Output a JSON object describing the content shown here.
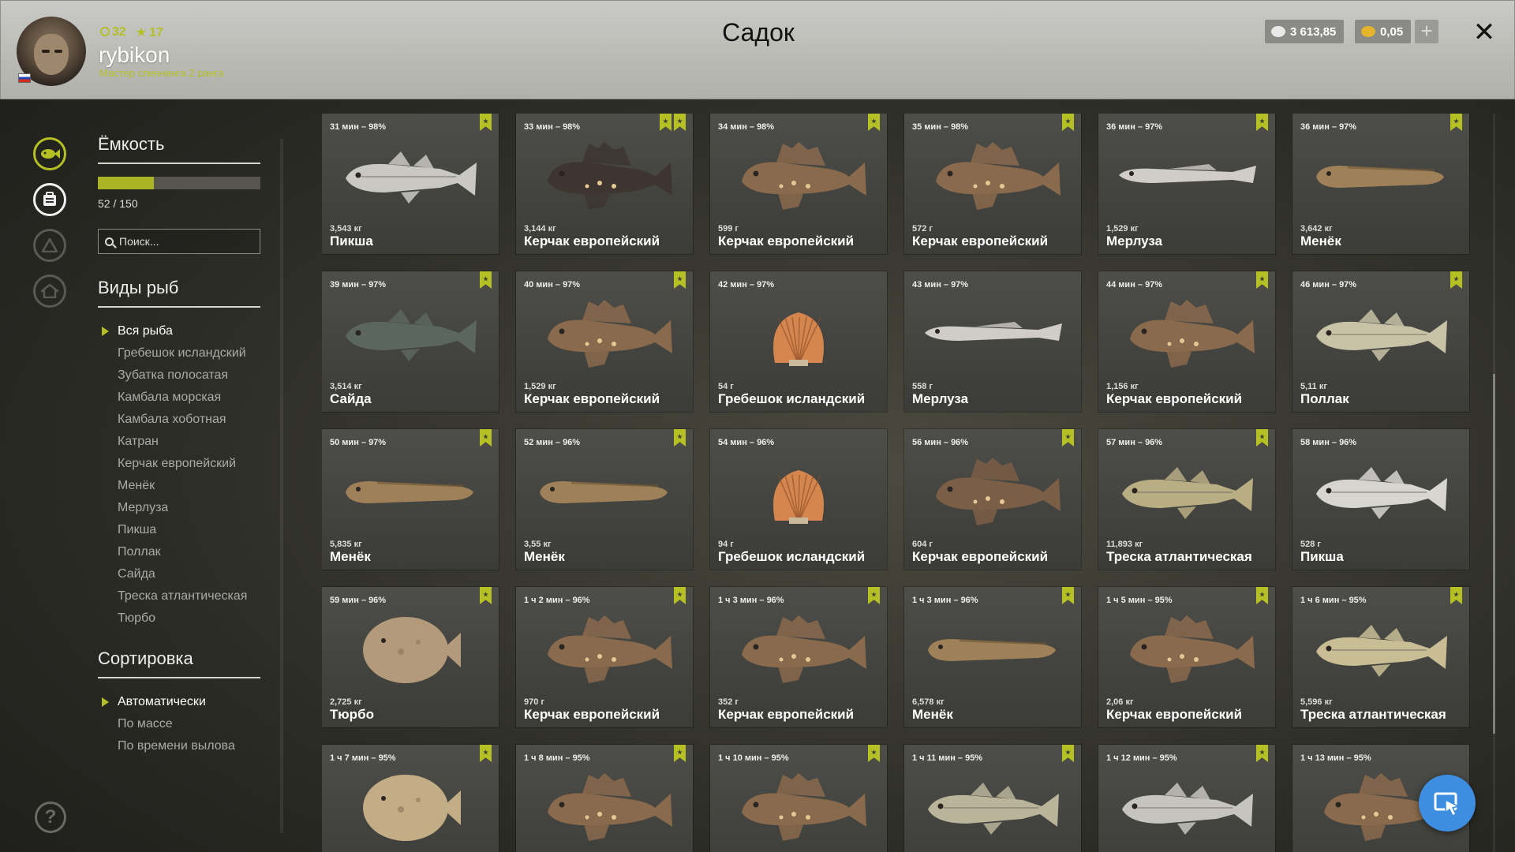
{
  "header": {
    "title": "Садок",
    "username": "rybikon",
    "rank_title": "Мастер спиннинга 2 ранга",
    "level": "32",
    "stars": "17",
    "silver": "3 613,85",
    "gold": "0,05",
    "plus_label": "+",
    "close_label": "✕"
  },
  "sidebar": {
    "capacity_title": "Ёмкость",
    "capacity_used": 52,
    "capacity_max": 150,
    "capacity_text": "52 / 150",
    "search_placeholder": "Поиск...",
    "species_title": "Виды рыб",
    "species": [
      "Вся рыба",
      "Гребешок исландский",
      "Зубатка полосатая",
      "Камбала морская",
      "Камбала хоботная",
      "Катран",
      "Керчак европейский",
      "Менёк",
      "Мерлуза",
      "Пикша",
      "Поллак",
      "Сайда",
      "Треска атлантическая",
      "Тюрбо"
    ],
    "species_selected": 0,
    "sort_title": "Сортировка",
    "sort_options": [
      "Автоматически",
      "По массе",
      "По времени вылова"
    ],
    "sort_selected": 0,
    "help_label": "?"
  },
  "colors": {
    "accent": "#b4c024",
    "fab": "#3d8de0"
  },
  "fish": [
    {
      "time": "31 мин – 98%",
      "weight": "3,543 кг",
      "name": "Пикша",
      "kind": "cod",
      "color": "#c9c8c2",
      "marks": 1
    },
    {
      "time": "33 мин – 98%",
      "weight": "3,144 кг",
      "name": "Керчак европейский",
      "kind": "sculpin",
      "color": "#3e3530",
      "marks": 2
    },
    {
      "time": "34 мин – 98%",
      "weight": "599 г",
      "name": "Керчак европейский",
      "kind": "sculpin",
      "color": "#8a6a4c",
      "marks": 1
    },
    {
      "time": "35 мин – 98%",
      "weight": "572 г",
      "name": "Керчак европейский",
      "kind": "sculpin",
      "color": "#8a6a4c",
      "marks": 1
    },
    {
      "time": "36 мин – 97%",
      "weight": "1,529 кг",
      "name": "Мерлуза",
      "kind": "hake",
      "color": "#d0ccc8",
      "marks": 1
    },
    {
      "time": "36 мин – 97%",
      "weight": "3,642 кг",
      "name": "Менёк",
      "kind": "eel",
      "color": "#9e8158",
      "marks": 1
    },
    {
      "time": "39 мин – 97%",
      "weight": "3,514 кг",
      "name": "Сайда",
      "kind": "cod",
      "color": "#5c6660",
      "marks": 1
    },
    {
      "time": "40 мин – 97%",
      "weight": "1,529 кг",
      "name": "Керчак европейский",
      "kind": "sculpin",
      "color": "#8a6a4c",
      "marks": 1
    },
    {
      "time": "42 мин – 97%",
      "weight": "54 г",
      "name": "Гребешок исландский",
      "kind": "shell",
      "color": "#d4864e",
      "marks": 0
    },
    {
      "time": "43 мин – 97%",
      "weight": "558 г",
      "name": "Мерлуза",
      "kind": "hake",
      "color": "#d0ccc8",
      "marks": 0
    },
    {
      "time": "44 мин – 97%",
      "weight": "1,156 кг",
      "name": "Керчак европейский",
      "kind": "sculpin",
      "color": "#8a6a4c",
      "marks": 1
    },
    {
      "time": "46 мин – 97%",
      "weight": "5,11 кг",
      "name": "Поллак",
      "kind": "cod",
      "color": "#c8c2a6",
      "marks": 1
    },
    {
      "time": "50 мин – 97%",
      "weight": "5,835 кг",
      "name": "Менёк",
      "kind": "eel",
      "color": "#9e8158",
      "marks": 1
    },
    {
      "time": "52 мин – 96%",
      "weight": "3,55 кг",
      "name": "Менёк",
      "kind": "eel",
      "color": "#9e8158",
      "marks": 1
    },
    {
      "time": "54 мин – 96%",
      "weight": "94 г",
      "name": "Гребешок исландский",
      "kind": "shell",
      "color": "#d4864e",
      "marks": 0
    },
    {
      "time": "56 мин – 96%",
      "weight": "604 г",
      "name": "Керчак европейский",
      "kind": "sculpin",
      "color": "#7a5e46",
      "marks": 1
    },
    {
      "time": "57 мин – 96%",
      "weight": "11,893 кг",
      "name": "Треска атлантическая",
      "kind": "cod",
      "color": "#b9ad84",
      "marks": 1
    },
    {
      "time": "58 мин – 96%",
      "weight": "528 г",
      "name": "Пикша",
      "kind": "cod",
      "color": "#d6d5d0",
      "marks": 0
    },
    {
      "time": "59 мин – 96%",
      "weight": "2,725 кг",
      "name": "Тюрбо",
      "kind": "flat",
      "color": "#b39a7a",
      "marks": 1
    },
    {
      "time": "1 ч 2 мин – 96%",
      "weight": "970 г",
      "name": "Керчак европейский",
      "kind": "sculpin",
      "color": "#8a6a4c",
      "marks": 1
    },
    {
      "time": "1 ч 3 мин – 96%",
      "weight": "352 г",
      "name": "Керчак европейский",
      "kind": "sculpin",
      "color": "#8a6a4c",
      "marks": 1
    },
    {
      "time": "1 ч 3 мин – 96%",
      "weight": "6,578 кг",
      "name": "Менёк",
      "kind": "eel",
      "color": "#9e8158",
      "marks": 1
    },
    {
      "time": "1 ч 5 мин – 95%",
      "weight": "2,06 кг",
      "name": "Керчак европейский",
      "kind": "sculpin",
      "color": "#8a6a4c",
      "marks": 1
    },
    {
      "time": "1 ч 6 мин – 95%",
      "weight": "5,596 кг",
      "name": "Треска атлантическая",
      "kind": "cod",
      "color": "#c8bd94",
      "marks": 1
    },
    {
      "time": "1 ч 7 мин – 95%",
      "weight": "",
      "name": "",
      "kind": "flat",
      "color": "#c2ad86",
      "marks": 1
    },
    {
      "time": "1 ч 8 мин – 95%",
      "weight": "",
      "name": "",
      "kind": "sculpin",
      "color": "#8a6a4c",
      "marks": 1
    },
    {
      "time": "1 ч 10 мин – 95%",
      "weight": "",
      "name": "",
      "kind": "sculpin",
      "color": "#8a6a4c",
      "marks": 1
    },
    {
      "time": "1 ч 11 мин – 95%",
      "weight": "",
      "name": "",
      "kind": "cod",
      "color": "#b9b49a",
      "marks": 1
    },
    {
      "time": "1 ч 12 мин – 95%",
      "weight": "",
      "name": "",
      "kind": "cod",
      "color": "#c6c4be",
      "marks": 1
    },
    {
      "time": "1 ч 13 мин – 95%",
      "weight": "",
      "name": "",
      "kind": "sculpin",
      "color": "#8a6a4c",
      "marks": 0
    }
  ]
}
